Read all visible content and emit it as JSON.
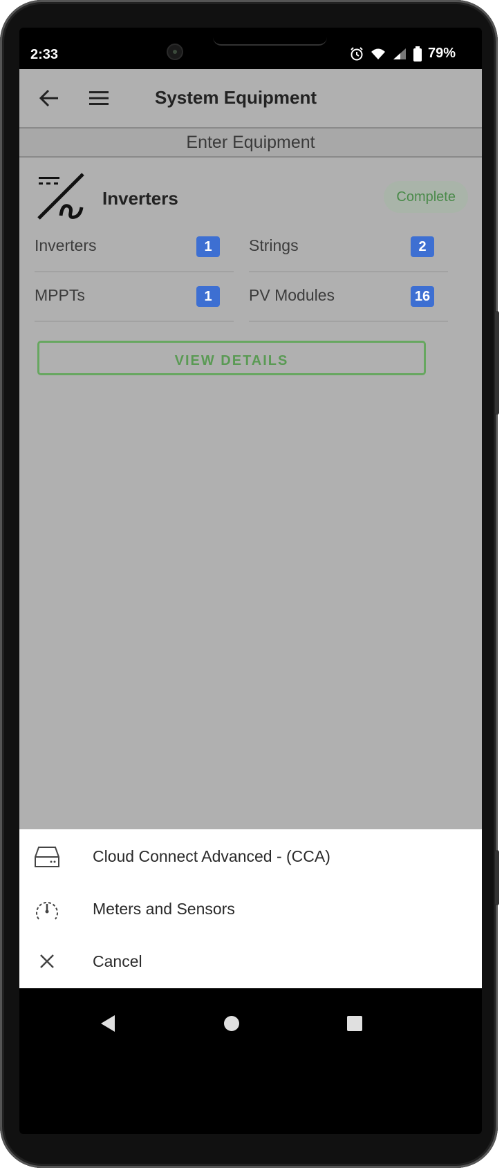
{
  "status_bar": {
    "time": "2:33",
    "battery": "79%"
  },
  "app_bar": {
    "title": "System Equipment"
  },
  "section": {
    "header": "Enter Equipment"
  },
  "card": {
    "title": "Inverters",
    "status": "Complete",
    "stats": [
      {
        "label": "Inverters",
        "count": "1"
      },
      {
        "label": "Strings",
        "count": "2"
      },
      {
        "label": "MPPTs",
        "count": "1"
      },
      {
        "label": "PV Modules",
        "count": "16"
      }
    ],
    "button_label": "VIEW DETAILS"
  },
  "sheet": {
    "items": [
      {
        "label": "Cloud Connect Advanced - (CCA)",
        "icon": "router-icon"
      },
      {
        "label": "Meters and Sensors",
        "icon": "gauge-icon"
      },
      {
        "label": "Cancel",
        "icon": "close-icon"
      }
    ]
  },
  "colors": {
    "accent_green": "#5a9a54",
    "badge_blue": "#3d6fd2",
    "overlay_gray": "#b0b0b0"
  }
}
